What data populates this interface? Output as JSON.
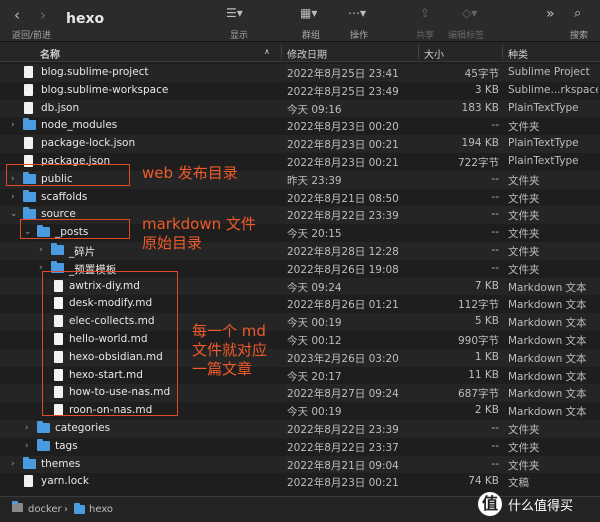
{
  "toolbar": {
    "nav_label": "返回/前进",
    "title": "hexo",
    "view_label": "显示",
    "group_label": "群组",
    "action_label": "操作",
    "share_label": "共享",
    "tag_label": "编辑标签",
    "search_label": "搜索"
  },
  "columns": {
    "name": "名称",
    "date": "修改日期",
    "size": "大小",
    "kind": "种类"
  },
  "rows": [
    {
      "name": "blog.sublime-project",
      "date": "2022年8月25日 23:41",
      "size": "45字节",
      "kind": "Sublime Project"
    },
    {
      "name": "blog.sublime-workspace",
      "date": "2022年8月25日 23:49",
      "size": "3 KB",
      "kind": "Sublime...rkspace"
    },
    {
      "name": "db.json",
      "date": "今天 09:16",
      "size": "183 KB",
      "kind": "PlainTextType"
    },
    {
      "name": "node_modules",
      "date": "2022年8月23日 00:20",
      "size": "--",
      "kind": "文件夹"
    },
    {
      "name": "package-lock.json",
      "date": "2022年8月23日 00:21",
      "size": "194 KB",
      "kind": "PlainTextType"
    },
    {
      "name": "package.json",
      "date": "2022年8月23日 00:21",
      "size": "722字节",
      "kind": "PlainTextType"
    },
    {
      "name": "public",
      "date": "昨天 23:39",
      "size": "--",
      "kind": "文件夹"
    },
    {
      "name": "scaffolds",
      "date": "2022年8月21日 08:50",
      "size": "--",
      "kind": "文件夹"
    },
    {
      "name": "source",
      "date": "2022年8月22日 23:39",
      "size": "--",
      "kind": "文件夹"
    },
    {
      "name": "_posts",
      "date": "今天 20:15",
      "size": "--",
      "kind": "文件夹"
    },
    {
      "name": "_碎片",
      "date": "2022年8月28日 12:28",
      "size": "--",
      "kind": "文件夹"
    },
    {
      "name": "_预置模板",
      "date": "2022年8月26日 19:08",
      "size": "--",
      "kind": "文件夹"
    },
    {
      "name": "awtrix-diy.md",
      "date": "今天 09:24",
      "size": "7 KB",
      "kind": "Markdown 文本"
    },
    {
      "name": "desk-modify.md",
      "date": "2022年8月26日 01:21",
      "size": "112字节",
      "kind": "Markdown 文本"
    },
    {
      "name": "elec-collects.md",
      "date": "今天 00:19",
      "size": "5 KB",
      "kind": "Markdown 文本"
    },
    {
      "name": "hello-world.md",
      "date": "今天 00:12",
      "size": "990字节",
      "kind": "Markdown 文本"
    },
    {
      "name": "hexo-obsidian.md",
      "date": "2023年2月26日 03:20",
      "size": "1 KB",
      "kind": "Markdown 文本"
    },
    {
      "name": "hexo-start.md",
      "date": "今天 20:17",
      "size": "11 KB",
      "kind": "Markdown 文本"
    },
    {
      "name": "how-to-use-nas.md",
      "date": "2022年8月27日 09:24",
      "size": "687字节",
      "kind": "Markdown 文本"
    },
    {
      "name": "roon-on-nas.md",
      "date": "今天 00:19",
      "size": "2 KB",
      "kind": "Markdown 文本"
    },
    {
      "name": "categories",
      "date": "2022年8月22日 23:39",
      "size": "--",
      "kind": "文件夹"
    },
    {
      "name": "tags",
      "date": "2022年8月22日 23:37",
      "size": "--",
      "kind": "文件夹"
    },
    {
      "name": "themes",
      "date": "2022年8月21日 09:04",
      "size": "--",
      "kind": "文件夹"
    },
    {
      "name": "yarn.lock",
      "date": "2022年8月23日 00:21",
      "size": "74 KB",
      "kind": "文稿"
    }
  ],
  "statusbar": {
    "path_1": "docker",
    "path_sep": "›",
    "path_2": "hexo"
  },
  "annotations": {
    "public_note": "web 发布目录",
    "posts_note_1": "markdown 文件",
    "posts_note_2": "原始目录",
    "md_note_1": "每一个 md",
    "md_note_2": "文件就对应",
    "md_note_3": "一篇文章"
  },
  "watermark": {
    "badge": "值",
    "text": "什么值得买"
  },
  "colors": {
    "folder": "#4a9be0",
    "annotation": "#e14a26"
  }
}
